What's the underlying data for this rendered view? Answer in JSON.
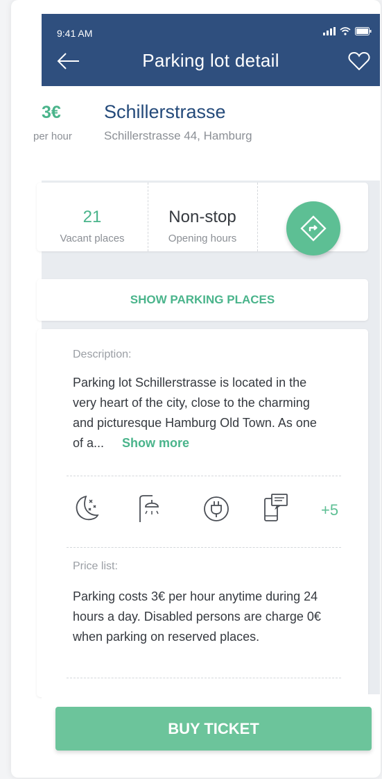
{
  "status_bar": {
    "time": "9:41 AM"
  },
  "header": {
    "title": "Parking lot detail"
  },
  "lot": {
    "price": "3€",
    "price_unit": "per hour",
    "name": "Schillerstrasse",
    "address": "Schillerstrasse 44, Hamburg"
  },
  "stats": {
    "vacant_value": "21",
    "vacant_label": "Vacant places",
    "hours_value": "Non-stop",
    "hours_label": "Opening hours"
  },
  "show_places_label": "SHOW PARKING PLACES",
  "description": {
    "label": "Description:",
    "text": "Parking lot Schillerstrasse is located in the very heart of the city, close to the charming and picturesque Hamburg Old Town. As one of a...",
    "show_more": "Show more"
  },
  "amenities": {
    "icons": [
      "night-icon",
      "shower-icon",
      "electric-plug-icon",
      "mobile-payment-icon"
    ],
    "more": "+5"
  },
  "price_list": {
    "label": "Price list:",
    "text": "Parking costs 3€ per hour anytime during 24 hours a day. Disabled persons are charge 0€ when parking on reserved places."
  },
  "buy_label": "BUY TICKET",
  "colors": {
    "header": "#2f4f7e",
    "accent_green": "#4ab48b",
    "button_green": "#6cc49b",
    "name_blue": "#244a7a"
  }
}
